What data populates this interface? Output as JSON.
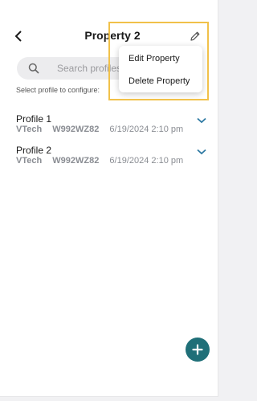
{
  "header": {
    "title": "Property 2",
    "back_icon": "chevron-left-icon",
    "edit_icon": "pencil-icon"
  },
  "search": {
    "placeholder": "Search profiles",
    "value": ""
  },
  "instruction": "Select profile to configure:",
  "profiles": [
    {
      "name": "Profile 1",
      "brand": "VTech",
      "model": "W992WZ82",
      "timestamp": "6/19/2024  2:10 pm"
    },
    {
      "name": "Profile 2",
      "brand": "VTech",
      "model": "W992WZ82",
      "timestamp": "6/19/2024  2:10 pm"
    }
  ],
  "menu": {
    "items": [
      {
        "label": "Edit Property"
      },
      {
        "label": "Delete Property"
      }
    ]
  },
  "colors": {
    "accent": "#1f6f78",
    "chevron": "#2f7aa3",
    "highlight": "#f1c14a"
  }
}
